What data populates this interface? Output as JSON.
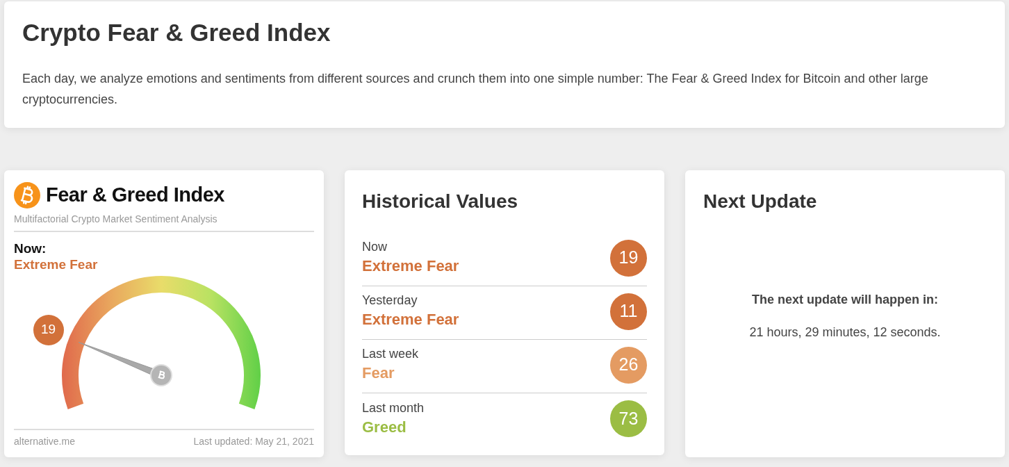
{
  "header": {
    "title": "Crypto Fear & Greed Index",
    "description": "Each day, we analyze emotions and sentiments from different sources and crunch them into one simple number: The Fear & Greed Index for Bitcoin and other large cryptocurrencies."
  },
  "widget": {
    "title": "Fear & Greed Index",
    "subtitle": "Multifactorial Crypto Market Sentiment Analysis",
    "now_label": "Now:",
    "now_value": "Extreme Fear",
    "gauge": {
      "reading": "19"
    },
    "source": "alternative.me",
    "updated": "Last updated: May 21, 2021"
  },
  "history": {
    "title": "Historical Values",
    "items": [
      {
        "period": "Now",
        "classification": "Extreme Fear",
        "value": "19",
        "color": "#d2713a"
      },
      {
        "period": "Yesterday",
        "classification": "Extreme Fear",
        "value": "11",
        "color": "#d2713a"
      },
      {
        "period": "Last week",
        "classification": "Fear",
        "value": "26",
        "color": "#e49b62"
      },
      {
        "period": "Last month",
        "classification": "Greed",
        "value": "73",
        "color": "#9bbd44"
      }
    ]
  },
  "next_update": {
    "title": "Next Update",
    "label": "The next update will happen in:",
    "countdown": "21 hours, 29 minutes, 12 seconds."
  }
}
